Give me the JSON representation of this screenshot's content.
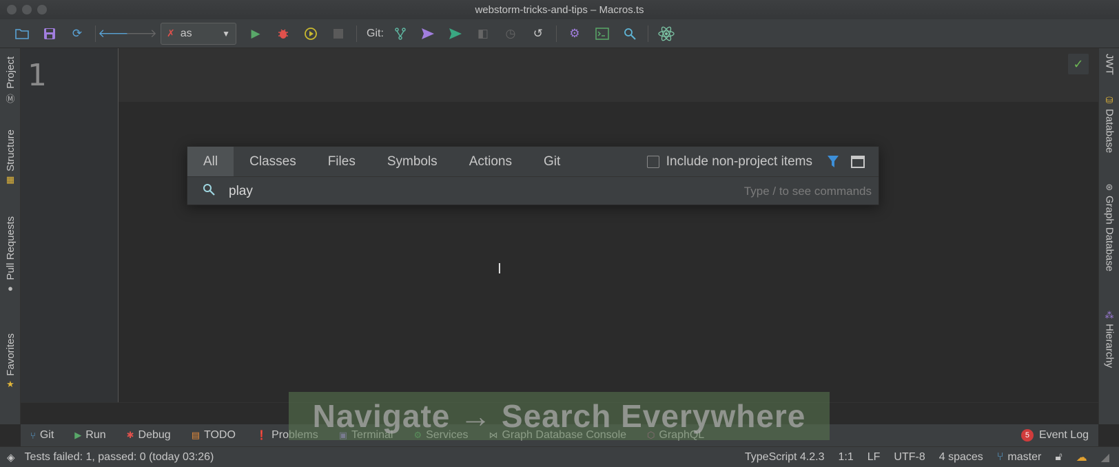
{
  "window": {
    "title": "webstorm-tricks-and-tips – Macros.ts"
  },
  "toolbar": {
    "run_config": "as",
    "git_label": "Git:",
    "icons": [
      "open-folder-icon",
      "save-icon",
      "sync-icon",
      "back-icon",
      "forward-icon",
      "run-icon",
      "debug-icon",
      "coverage-icon",
      "stop-icon",
      "git-branches-icon",
      "git-push-icon",
      "git-commit-icon",
      "git-compare-icon",
      "git-history-icon",
      "git-rollback-icon",
      "settings-icon",
      "terminal-icon",
      "find-icon",
      "react-icon"
    ],
    "colors": {
      "run": "#59a869",
      "debug": "#e0514c",
      "push": "#a17ede",
      "settings": "#a17ede"
    }
  },
  "left_strip": {
    "items": [
      {
        "label": "Project",
        "icon": "project-icon"
      },
      {
        "label": "Structure",
        "icon": "structure-icon"
      },
      {
        "label": "Pull Requests",
        "icon": "github-icon"
      },
      {
        "label": "Favorites",
        "icon": "star-icon"
      }
    ]
  },
  "right_strip": {
    "items": [
      {
        "label": "JWT"
      },
      {
        "label": "Database",
        "icon": "database-icon"
      },
      {
        "label": "Graph Database",
        "icon": "graph-icon"
      },
      {
        "label": "Hierarchy",
        "icon": "hierarchy-icon"
      }
    ]
  },
  "editor": {
    "line_number": "1"
  },
  "search_popup": {
    "tabs": [
      "All",
      "Classes",
      "Files",
      "Symbols",
      "Actions",
      "Git"
    ],
    "active_tab": "All",
    "include_label": "Include non-project items",
    "include_checked": false,
    "query": "play",
    "hint": "Type / to see commands"
  },
  "overlay": {
    "text": "Navigate → Search Everywhere"
  },
  "bottom_tabs": [
    {
      "label": "Git",
      "icon": "git-icon"
    },
    {
      "label": "Run",
      "icon": "run-icon"
    },
    {
      "label": "Debug",
      "icon": "bug-icon"
    },
    {
      "label": "TODO",
      "icon": "todo-icon"
    },
    {
      "label": "Problems",
      "icon": "problems-icon"
    },
    {
      "label": "Terminal",
      "icon": "terminal-icon"
    },
    {
      "label": "Services",
      "icon": "services-icon"
    },
    {
      "label": "Graph Database Console",
      "icon": "share-icon"
    },
    {
      "label": "GraphQL",
      "icon": "graphql-icon"
    }
  ],
  "event_log": {
    "count": "5",
    "label": "Event Log"
  },
  "status": {
    "message": "Tests failed: 1, passed: 0 (today 03:26)",
    "language": "TypeScript 4.2.3",
    "position": "1:1",
    "line_sep": "LF",
    "encoding": "UTF-8",
    "indent": "4 spaces",
    "branch": "master"
  }
}
